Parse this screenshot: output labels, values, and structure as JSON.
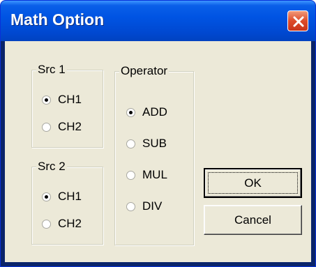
{
  "window": {
    "title": "Math Option"
  },
  "src1": {
    "label": "Src 1",
    "options": [
      "CH1",
      "CH2"
    ],
    "selected": "CH1"
  },
  "src2": {
    "label": "Src 2",
    "options": [
      "CH1",
      "CH2"
    ],
    "selected": "CH1"
  },
  "operator": {
    "label": "Operator",
    "options": [
      "ADD",
      "SUB",
      "MUL",
      "DIV"
    ],
    "selected": "ADD"
  },
  "buttons": {
    "ok": "OK",
    "cancel": "Cancel"
  },
  "icons": {
    "close": "close-icon"
  },
  "colors": {
    "titlebar": "#0054e3",
    "client": "#ece9d8",
    "close": "#dd4b2a"
  }
}
